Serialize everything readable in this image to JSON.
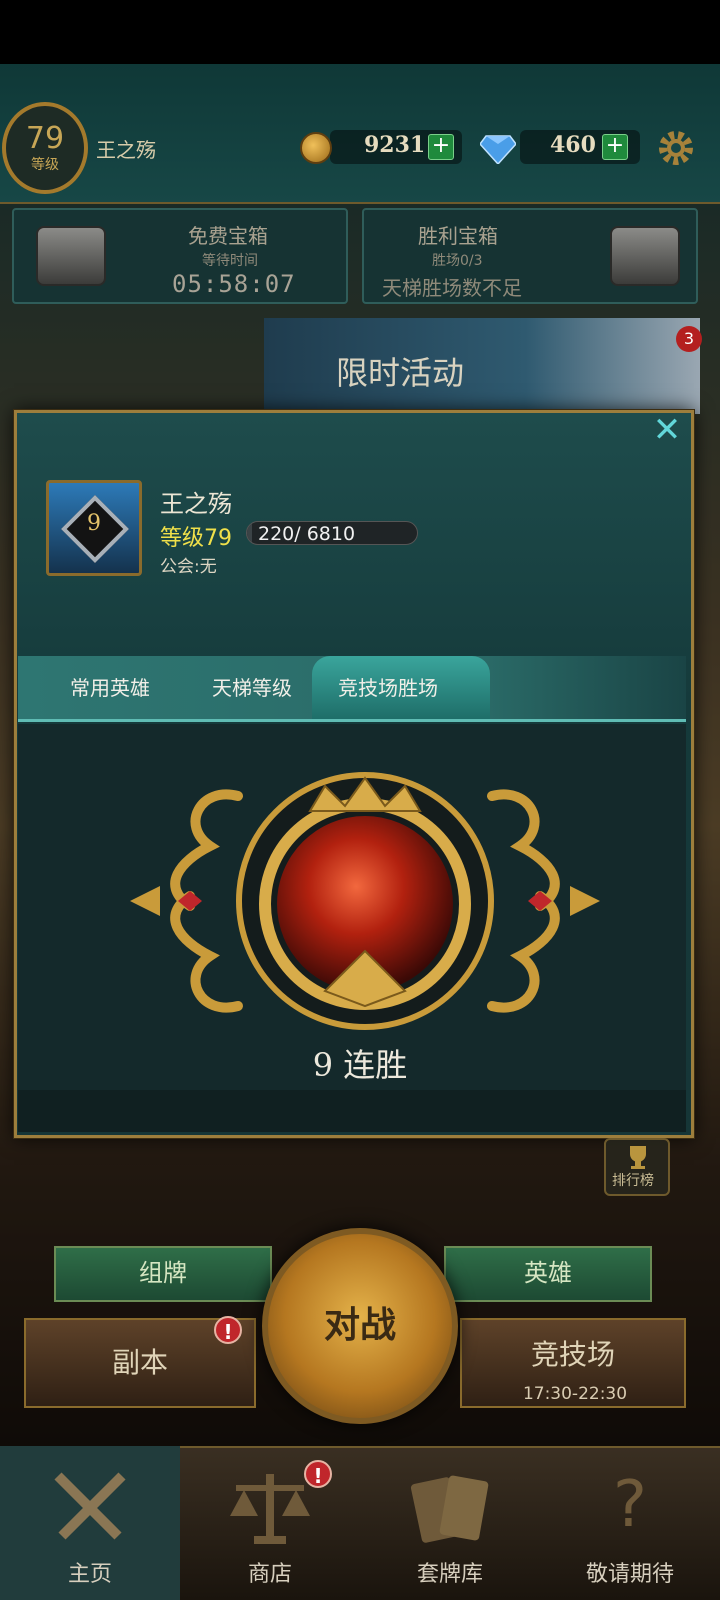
{
  "header": {
    "level": "79",
    "level_label": "等级",
    "player_name": "王之殇",
    "gold": "9231",
    "gems": "460",
    "plus": "+"
  },
  "chests": {
    "free": {
      "title": "免费宝箱",
      "sub": "等待时间",
      "timer": "05:58:07"
    },
    "victory": {
      "title": "胜利宝箱",
      "sub": "胜场0/3",
      "status": "天梯胜场数不足"
    }
  },
  "event": {
    "title": "限时活动",
    "badge": "3"
  },
  "profile_dialog": {
    "close": "✕",
    "avatar_rank": "9",
    "name": "王之殇",
    "level_label": "等级79",
    "xp_text": "220/ 6810",
    "xp_progress": 0.032,
    "guild": "公会:无",
    "tabs": [
      "常用英雄",
      "天梯等级",
      "竞技场胜场"
    ],
    "active_tab": 2,
    "streak_text": "9 连胜"
  },
  "lobby": {
    "rank_label": "排行榜",
    "deck_button": "组牌",
    "hero_button": "英雄",
    "dungeon_button": "副本",
    "battle_button": "对战",
    "arena_button": "竞技场",
    "arena_time": "17:30-22:30",
    "alert": "!"
  },
  "bottom_nav": [
    {
      "label": "主页",
      "icon": "crossed-swords-icon"
    },
    {
      "label": "商店",
      "icon": "scales-icon"
    },
    {
      "label": "套牌库",
      "icon": "cards-icon"
    },
    {
      "label": "敬请期待",
      "icon": "question-icon"
    }
  ],
  "colors": {
    "accent_teal": "#5fbcb4",
    "gold_border": "#9d7e3c",
    "level_yellow": "#f0e04a"
  }
}
